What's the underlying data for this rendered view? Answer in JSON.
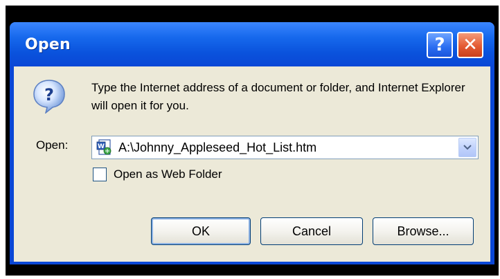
{
  "window": {
    "title": "Open",
    "help_glyph": "?",
    "close_glyph": "✕"
  },
  "dialog": {
    "icon": "question-icon",
    "message": "Type the Internet address of a document or folder, and Internet Explorer will open it for you.",
    "open_label": "Open:",
    "open_value": "A:\\Johnny_Appleseed_Hot_List.htm",
    "file_icon": "word-document-icon",
    "checkbox_label": "Open as Web Folder",
    "checkbox_checked": false
  },
  "buttons": {
    "ok": "OK",
    "cancel": "Cancel",
    "browse": "Browse..."
  },
  "colors": {
    "titlebar": "#0a47d6",
    "client": "#ece9d8",
    "close": "#e45b33",
    "help": "#2a6df1"
  }
}
